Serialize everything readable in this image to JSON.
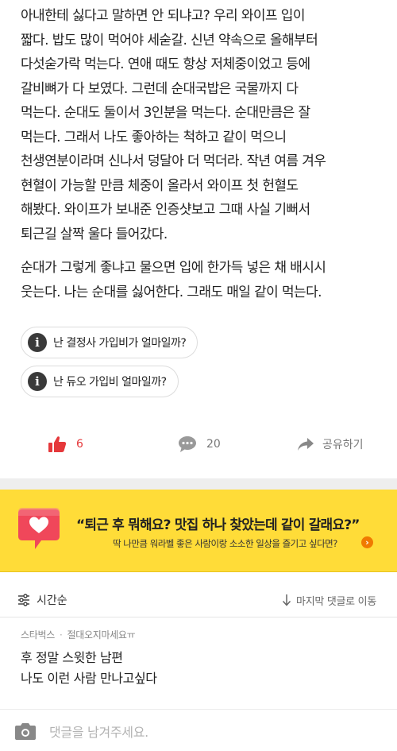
{
  "article": {
    "paragraph1": [
      " 아내한테 싫다고 말하면 안 되냐고? 우리 와이프 입이",
      "짧다. 밥도 많이 먹어야 세숟갈. 신년 약속으로 올해부터",
      "다섯숟가락 먹는다. 연애 때도 항상 저체중이었고 등에",
      "갈비뼈가 다 보였다. 그런데 순대국밥은 국물까지 다",
      "먹는다. 순대도 둘이서 3인분을 먹는다. 순대만큼은 잘",
      "먹는다. 그래서 나도 좋아하는 척하고 같이 먹으니",
      "천생연분이라며 신나서 덩달아 더 먹더라. 작년 여름 겨우",
      "현혈이 가능할 만큼 체중이 올라서 와이프 첫 헌혈도",
      "해봤다. 와이프가 보내준 인증샷보고 그때 사실 기뻐서",
      "퇴근길 살짝 울다 들어갔다."
    ],
    "paragraph2": [
      " 순대가 그렇게 좋냐고 물으면 입에 한가득 넣은 채 배시시",
      "웃는다. 나는 순대를 싫어한다. 그래도 매일 같이 먹는다."
    ]
  },
  "questions": [
    {
      "label": "난 결정사 가입비가 얼마일까?",
      "icon": "info-icon"
    },
    {
      "label": "난 듀오 가입비 얼마일까?",
      "icon": "info-icon"
    }
  ],
  "actions": {
    "like_count": "6",
    "comment_count": "20",
    "share_label": "공유하기"
  },
  "banner": {
    "title": "“퇴근 후 뭐해요? 맛집 하나 찾았는데 같이 갈래요?”",
    "subtitle": "딱 나만큼 워라벨 좋은 사람이랑 소소한 일상을 즐기고 싶다면?",
    "background": "#ffdc38",
    "icon_color": "#f0475a"
  },
  "comments_bar": {
    "sort_label": "시간순",
    "jump_label": "마지막 댓글로 이동"
  },
  "comment": {
    "company": "스타벅스",
    "author": "절대오지마세요ㅠ",
    "lines": [
      "후 정말 스윗한 남편",
      "나도 이런 사람 만나고싶다"
    ]
  },
  "input": {
    "placeholder": "댓글을 남겨주세요."
  },
  "colors": {
    "accent_red": "#e5383b",
    "text_primary": "#222222",
    "text_muted": "#888888"
  }
}
